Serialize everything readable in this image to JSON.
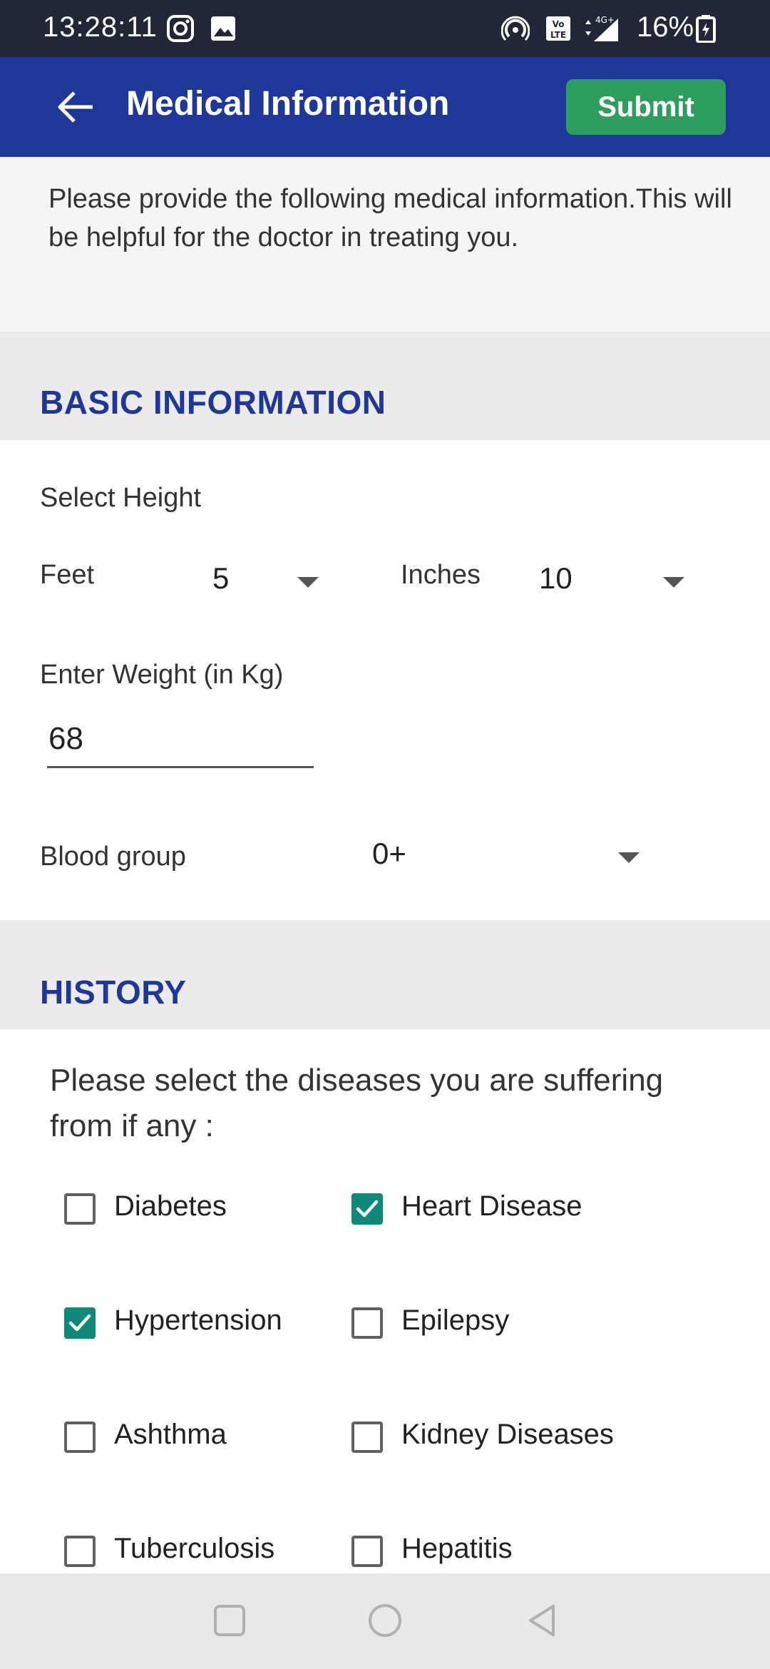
{
  "status_bar": {
    "time": "13:28:11",
    "battery": "16%",
    "icons": [
      "instagram-icon",
      "gallery-icon",
      "hotspot-icon",
      "volte-icon",
      "signal-4g-icon",
      "battery-icon"
    ]
  },
  "app_bar": {
    "back_icon": "arrow-left-icon",
    "title": "Medical Information",
    "submit_label": "Submit",
    "colors": {
      "bar": "#1e3799",
      "submit": "#2e9e5e"
    }
  },
  "intro": {
    "text": "Please provide the following medical information.This will be helpful for the doctor in treating you."
  },
  "basic_information": {
    "section_title": "BASIC INFORMATION",
    "height_label": "Select Height",
    "feet_label": "Feet",
    "feet_value": "5",
    "inches_label": "Inches",
    "inches_value": "10",
    "weight_label": "Enter Weight (in Kg)",
    "weight_value": "68",
    "blood_group_label": "Blood group",
    "blood_group_value": "0+"
  },
  "history": {
    "section_title": "HISTORY",
    "prompt": "Please select the diseases you are suffering from if any :",
    "diseases": [
      {
        "label": "Diabetes",
        "checked": false
      },
      {
        "label": "Heart Disease",
        "checked": true
      },
      {
        "label": "Hypertension",
        "checked": true
      },
      {
        "label": "Epilepsy",
        "checked": false
      },
      {
        "label": "Ashthma",
        "checked": false
      },
      {
        "label": "Kidney Diseases",
        "checked": false
      },
      {
        "label": "Tuberculosis",
        "checked": false
      },
      {
        "label": "Hepatitis",
        "checked": false
      }
    ],
    "check_color": "#0f8a7a"
  },
  "nav_bar": {
    "icons": [
      "recents-square-icon",
      "home-circle-icon",
      "back-triangle-icon"
    ]
  }
}
